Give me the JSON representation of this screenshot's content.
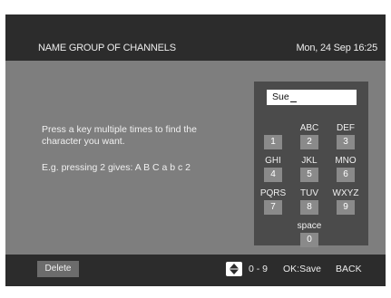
{
  "header": {
    "title": "NAME GROUP OF CHANNELS",
    "datetime": "Mon, 24 Sep 16:25"
  },
  "instructions": {
    "text": "Press a key multiple times to find the character you want.",
    "example": "E.g. pressing 2 gives:  A  B  C  a  b  c  2"
  },
  "name_field": {
    "value": "Sue"
  },
  "keypad": {
    "keys": [
      {
        "letters": "",
        "digit": "1"
      },
      {
        "letters": "ABC",
        "digit": "2"
      },
      {
        "letters": "DEF",
        "digit": "3"
      },
      {
        "letters": "GHI",
        "digit": "4"
      },
      {
        "letters": "JKL",
        "digit": "5"
      },
      {
        "letters": "MNO",
        "digit": "6"
      },
      {
        "letters": "PQRS",
        "digit": "7"
      },
      {
        "letters": "TUV",
        "digit": "8"
      },
      {
        "letters": "WXYZ",
        "digit": "9"
      },
      {
        "letters": "space",
        "digit": "0"
      }
    ]
  },
  "footer": {
    "delete_label": "Delete",
    "nav_icon": "up-down-arrows-icon",
    "digits_hint": "0 - 9",
    "save_hint": "OK:Save",
    "back_hint": "BACK"
  }
}
